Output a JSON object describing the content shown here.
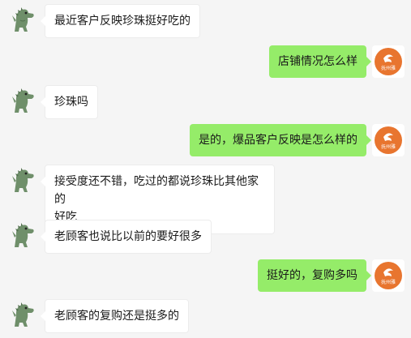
{
  "chat": {
    "messages": [
      {
        "sender": "customer_service",
        "text": "最近客户反映珍珠挺好吃的"
      },
      {
        "sender": "me",
        "text": "店铺情况怎么样"
      },
      {
        "sender": "customer_service",
        "text": "珍珠吗"
      },
      {
        "sender": "me",
        "text": "是的，爆品客户反映是怎么样的"
      },
      {
        "sender": "customer_service",
        "text": "接受度还不错，吃过的都说珍珠比其他家的\n好吃"
      },
      {
        "sender": "customer_service",
        "text": "老顾客也说比以前的要好很多"
      },
      {
        "sender": "me",
        "text": "挺好的，复购多吗"
      },
      {
        "sender": "customer_service",
        "text": "老顾客的复购还是挺多的"
      }
    ]
  },
  "avatars": {
    "left": {
      "icon": "dinosaur-avatar-icon",
      "color": "#6f8f6a"
    },
    "right": {
      "icon": "shop-logo-icon",
      "color": "#e8752f",
      "label": "抚州雅"
    }
  },
  "colors": {
    "background": "#f5f5f5",
    "incoming_bubble": "#ffffff",
    "outgoing_bubble": "#95ec69"
  }
}
